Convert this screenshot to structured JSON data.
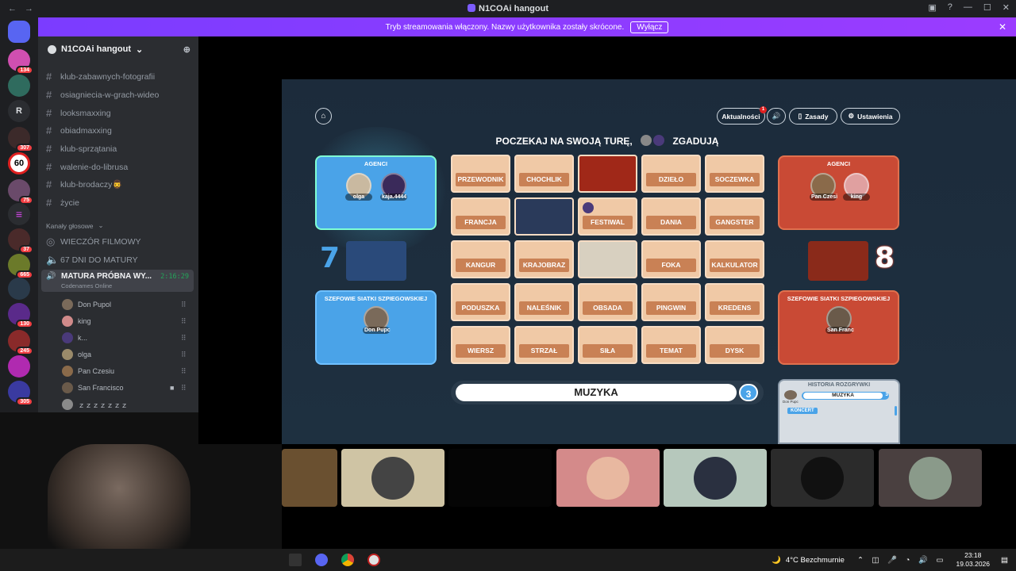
{
  "window": {
    "title": "N1COAi hangout"
  },
  "banner": {
    "text": "Tryb streamowania włączony. Nazwy użytkownika zostały skrócone.",
    "button": "Wyłącz"
  },
  "server_badges": [
    "134",
    "307",
    "60",
    "75",
    "37",
    "665",
    "130",
    "245",
    "305"
  ],
  "server_letter": "R",
  "sidebar": {
    "server_name": "N1COAi hangout",
    "text_channels": [
      "klub-zabawnych-fotografii",
      "osiagniecia-w-grach-wideo",
      "looksmaxxing",
      "obiadmaxxing",
      "klub-sprzątania",
      "walenie-do-librusa",
      "klub-brodaczy🧔‍♂️",
      "życie"
    ],
    "voice_header": "Kanały głosowe",
    "voice_channels": [
      "WIECZÓR FILMOWY",
      "67 DNI DO MATURY"
    ],
    "active_voice": {
      "name": "MATURA PRÓBNA WY...",
      "timer": "2:16:29",
      "activity": "Codenames Online"
    },
    "users": [
      "Don Pupol",
      "king",
      "k...",
      "olga",
      "Pan Czesiu",
      "San Francisco",
      "ｚｚｚｚｚｚｚ"
    ]
  },
  "game": {
    "buttons": {
      "news": "Aktualności",
      "news_badge": "1",
      "rules": "Zasady",
      "settings": "Ustawienia"
    },
    "status_left": "POCZEKAJ NA SWOJĄ TURĘ,",
    "status_right": "ZGADUJĄ",
    "blue_team": {
      "agents_label": "AGENCI",
      "agents": [
        "olga",
        "kaja.4444"
      ],
      "spymaster_label": "SZEFOWIE SIATKI SZPIEGOWSKIEJ",
      "spymaster": "Don Pupc",
      "score": "7"
    },
    "red_team": {
      "agents_label": "AGENCI",
      "agents": [
        "Pan Czesi",
        "king"
      ],
      "spymaster_label": "SZEFOWIE SIATKI SZPIEGOWSKIEJ",
      "spymaster": "San Franc",
      "score": "8"
    },
    "cards": [
      "PRZEWODNIK",
      "CHOCHLIK",
      "",
      "DZIEŁO",
      "SOCZEWKA",
      "FRANCJA",
      "",
      "FESTIWAL",
      "DANIA",
      "GANGSTER",
      "KANGUR",
      "KRAJOBRAZ",
      "",
      "FOKA",
      "KALKULATOR",
      "PODUSZKA",
      "NALEŚNIK",
      "OBSADA",
      "PINGWIN",
      "KREDENS",
      "WIERSZ",
      "STRZAŁ",
      "SIŁA",
      "TEMAT",
      "DYSK"
    ],
    "clue": {
      "word": "MUZYKA",
      "count": "3"
    },
    "history": {
      "title": "HISTORIA ROZGRYWKI",
      "clue": "MUZYKA",
      "clue_count": "3",
      "author": "Don Pupc",
      "guess": "KONCERT"
    }
  },
  "taskbar": {
    "weather": "4°C  Bezchmurnie",
    "time": "23:18",
    "date": "19.03.2026"
  },
  "colors": {
    "blue": "#4aa3e8",
    "red": "#c94a35",
    "card": "#f0c9a6",
    "label": "#c98155",
    "banner": "#8b3cff"
  }
}
